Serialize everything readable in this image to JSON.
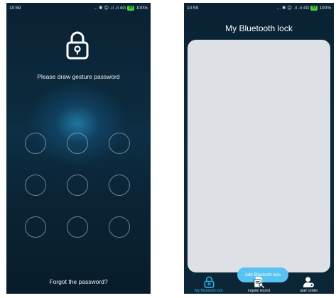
{
  "left_screen": {
    "status": {
      "time": "10:59",
      "icons": "... ✱ ☹ .ıl .ıl 4G",
      "battery": "100%"
    },
    "prompt": "Please draw gesture password",
    "forgot_link": "Forgot the password?",
    "pattern_dots": 9
  },
  "right_screen": {
    "status": {
      "time": "10:59",
      "icons": "... ✱ ☹ .ıl .ıl 4G",
      "battery": "100%"
    },
    "title": "My Bluetooth lock",
    "add_button": "Add Bluetooth lock",
    "tabs": [
      {
        "label": "My Bluetooth lock",
        "icon": "lock-icon",
        "active": true
      },
      {
        "label": "inquire record",
        "icon": "record-search-icon",
        "active": false
      },
      {
        "label": "user center",
        "icon": "user-settings-icon",
        "active": false
      }
    ]
  },
  "colors": {
    "dark_bg": "#0b2536",
    "accent": "#35b6ee",
    "button": "#58c2f2",
    "card": "#dde1e5"
  }
}
